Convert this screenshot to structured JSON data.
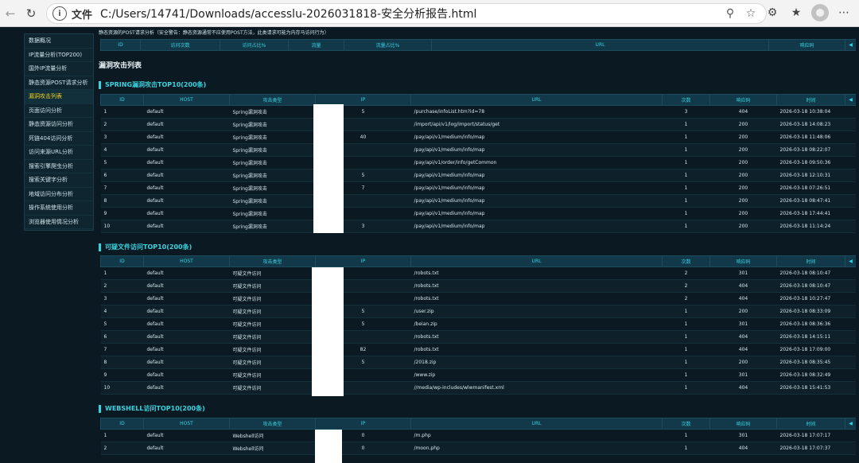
{
  "browser": {
    "label": "文件",
    "url": "C:/Users/14741/Downloads/accesslu-2026031818-安全分析报告.html"
  },
  "sidebar": {
    "items": [
      {
        "label": "数据概况"
      },
      {
        "label": "IP流量分析(TOP200)"
      },
      {
        "label": "国外IP流量分析"
      },
      {
        "label": "静态资源POST请求分析"
      },
      {
        "label": "漏洞攻击列表",
        "active": true
      },
      {
        "label": "页面访问分析"
      },
      {
        "label": "静态资源访问分析"
      },
      {
        "label": "死链404访问分析"
      },
      {
        "label": "访问来源URL分析"
      },
      {
        "label": "搜索引擎爬虫分析"
      },
      {
        "label": "搜索关键字分析"
      },
      {
        "label": "地域访问分布分析"
      },
      {
        "label": "操作系统使用分析"
      },
      {
        "label": "浏览器使用情况分析"
      }
    ]
  },
  "main": {
    "top_note": "静态资源的POST请求分析（安全警告：静态资源通常不应使用POST方法，此类请求可能为内存马访问行为）",
    "post_headers": [
      "ID",
      "访问次数",
      "访问占比%",
      "流量",
      "流量占比%",
      "URL",
      "响应码"
    ],
    "vuln_title": "漏洞攻击列表",
    "attack_headers": [
      "ID",
      "HOST",
      "攻击类型",
      "IP",
      "URL",
      "次数",
      "响应码",
      "时间"
    ],
    "spring": {
      "title": "SPRING漏洞攻击TOP10(200条)",
      "rows": [
        {
          "id": "1",
          "host": "default",
          "type": "Spring漏洞攻击",
          "ip": "5",
          "url": "/purchase/infoList.htm?id=78",
          "count": "3",
          "code": "404",
          "time": "2026-03-18 10:38:04"
        },
        {
          "id": "2",
          "host": "default",
          "type": "Spring漏洞攻击",
          "ip": "",
          "url": "/import/api/v1/log/import/status/get",
          "count": "1",
          "code": "200",
          "time": "2026-03-18 14:08:23"
        },
        {
          "id": "3",
          "host": "default",
          "type": "Spring漏洞攻击",
          "ip": "40",
          "url": "/pay/api/v1/medium/info/map",
          "count": "1",
          "code": "200",
          "time": "2026-03-18 11:48:06"
        },
        {
          "id": "4",
          "host": "default",
          "type": "Spring漏洞攻击",
          "ip": "",
          "url": "/pay/api/v1/medium/info/map",
          "count": "1",
          "code": "200",
          "time": "2026-03-18 08:22:07"
        },
        {
          "id": "5",
          "host": "default",
          "type": "Spring漏洞攻击",
          "ip": "",
          "url": "/pay/api/v1/order/info/getCommon",
          "count": "1",
          "code": "200",
          "time": "2026-03-18 09:50:36"
        },
        {
          "id": "6",
          "host": "default",
          "type": "Spring漏洞攻击",
          "ip": "5",
          "url": "/pay/api/v1/medium/info/map",
          "count": "1",
          "code": "200",
          "time": "2026-03-18 12:10:31"
        },
        {
          "id": "7",
          "host": "default",
          "type": "Spring漏洞攻击",
          "ip": "7",
          "url": "/pay/api/v1/medium/info/map",
          "count": "1",
          "code": "200",
          "time": "2026-03-18 07:26:51"
        },
        {
          "id": "8",
          "host": "default",
          "type": "Spring漏洞攻击",
          "ip": "",
          "url": "/pay/api/v1/medium/info/map",
          "count": "1",
          "code": "200",
          "time": "2026-03-18 08:47:41"
        },
        {
          "id": "9",
          "host": "default",
          "type": "Spring漏洞攻击",
          "ip": "",
          "url": "/pay/api/v1/medium/info/map",
          "count": "1",
          "code": "200",
          "time": "2026-03-18 17:44:41"
        },
        {
          "id": "10",
          "host": "default",
          "type": "Spring漏洞攻击",
          "ip": "3",
          "url": "/pay/api/v1/medium/info/map",
          "count": "1",
          "code": "200",
          "time": "2026-03-18 11:14:24"
        }
      ]
    },
    "suspicious": {
      "title": "可疑文件访问TOP10(200条)",
      "rows": [
        {
          "id": "1",
          "host": "default",
          "type": "可疑文件访问",
          "ip": "",
          "url": "/robots.txt",
          "count": "2",
          "code": "301",
          "time": "2026-03-18 08:10:47"
        },
        {
          "id": "2",
          "host": "default",
          "type": "可疑文件访问",
          "ip": "",
          "url": "/robots.txt",
          "count": "2",
          "code": "404",
          "time": "2026-03-18 08:10:47"
        },
        {
          "id": "3",
          "host": "default",
          "type": "可疑文件访问",
          "ip": "",
          "url": "/robots.txt",
          "count": "2",
          "code": "404",
          "time": "2026-03-18 10:27:47"
        },
        {
          "id": "4",
          "host": "default",
          "type": "可疑文件访问",
          "ip": "5",
          "url": "/user.zip",
          "count": "1",
          "code": "200",
          "time": "2026-03-18 08:33:09"
        },
        {
          "id": "5",
          "host": "default",
          "type": "可疑文件访问",
          "ip": "5",
          "url": "/beian.zip",
          "count": "1",
          "code": "301",
          "time": "2026-03-18 08:36:36"
        },
        {
          "id": "6",
          "host": "default",
          "type": "可疑文件访问",
          "ip": "",
          "url": "/robots.txt",
          "count": "1",
          "code": "404",
          "time": "2026-03-18 14:15:11"
        },
        {
          "id": "7",
          "host": "default",
          "type": "可疑文件访问",
          "ip": "82",
          "url": "/robots.txt",
          "count": "1",
          "code": "404",
          "time": "2026-03-18 17:09:00"
        },
        {
          "id": "8",
          "host": "default",
          "type": "可疑文件访问",
          "ip": "5",
          "url": "/2018.zip",
          "count": "1",
          "code": "200",
          "time": "2026-03-18 08:35:45"
        },
        {
          "id": "9",
          "host": "default",
          "type": "可疑文件访问",
          "ip": "",
          "url": "/www.zip",
          "count": "1",
          "code": "301",
          "time": "2026-03-18 08:32:49"
        },
        {
          "id": "10",
          "host": "default",
          "type": "可疑文件访问",
          "ip": "",
          "url": "//media/wp-includes/wlwmanifest.xml",
          "count": "1",
          "code": "404",
          "time": "2026-03-18 15:41:53"
        }
      ]
    },
    "webshell": {
      "title": "WEBSHELL访问TOP10(200条)",
      "rows": [
        {
          "id": "1",
          "host": "default",
          "type": "Webshell访问",
          "ip": "0",
          "url": "/m.php",
          "count": "1",
          "code": "301",
          "time": "2026-03-18 17:07:17"
        },
        {
          "id": "2",
          "host": "default",
          "type": "Webshell访问",
          "ip": "0",
          "url": "/moon.php",
          "count": "1",
          "code": "404",
          "time": "2026-03-18 17:07:37"
        }
      ]
    }
  }
}
